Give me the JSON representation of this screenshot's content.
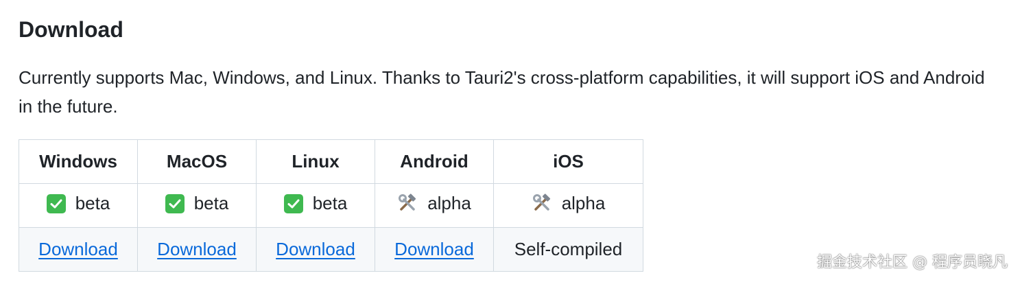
{
  "section": {
    "title": "Download",
    "description": "Currently supports Mac, Windows, and Linux. Thanks to Tauri2's cross-platform capabilities, it will support iOS and Android in the future."
  },
  "table": {
    "headers": [
      "Windows",
      "MacOS",
      "Linux",
      "Android",
      "iOS"
    ],
    "status": [
      {
        "icon": "check-mark-icon",
        "label": "beta"
      },
      {
        "icon": "check-mark-icon",
        "label": "beta"
      },
      {
        "icon": "check-mark-icon",
        "label": "beta"
      },
      {
        "icon": "hammer-wrench-icon",
        "label": "alpha"
      },
      {
        "icon": "hammer-wrench-icon",
        "label": "alpha"
      }
    ],
    "download": [
      {
        "label": "Download",
        "link": true
      },
      {
        "label": "Download",
        "link": true
      },
      {
        "label": "Download",
        "link": true
      },
      {
        "label": "Download",
        "link": true
      },
      {
        "label": "Self-compiled",
        "link": false
      }
    ]
  },
  "watermark": "掘金技术社区 @ 程序员晓凡",
  "colors": {
    "link": "#0969da",
    "check": "#3fb950",
    "border": "#d1d9e0",
    "stripe": "#f6f8fa"
  }
}
